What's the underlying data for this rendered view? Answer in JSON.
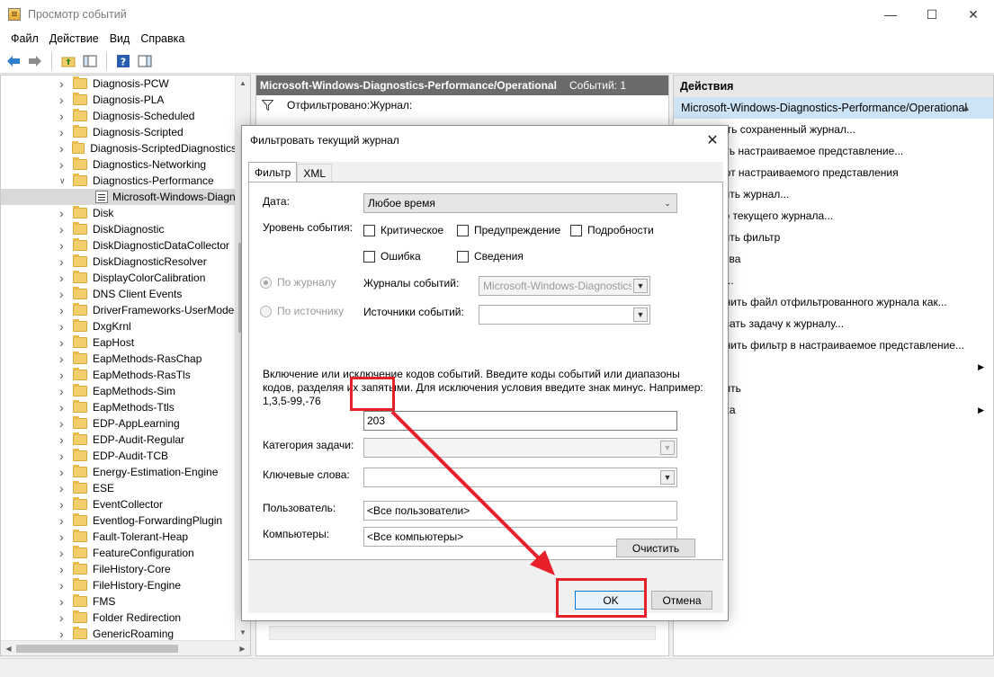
{
  "window": {
    "title": "Просмотр событий"
  },
  "menu": [
    "Файл",
    "Действие",
    "Вид",
    "Справка"
  ],
  "tree": {
    "items": [
      {
        "label": "Diagnosis-PCW",
        "expanded": false
      },
      {
        "label": "Diagnosis-PLA",
        "expanded": false
      },
      {
        "label": "Diagnosis-Scheduled",
        "expanded": false
      },
      {
        "label": "Diagnosis-Scripted",
        "expanded": false
      },
      {
        "label": "Diagnosis-ScriptedDiagnostics",
        "expanded": false
      },
      {
        "label": "Diagnostics-Networking",
        "expanded": false
      },
      {
        "label": "Diagnostics-Performance",
        "expanded": true
      },
      {
        "label": "Microsoft-Windows-Diagn",
        "child": true,
        "selected": true
      },
      {
        "label": "Disk",
        "expanded": false
      },
      {
        "label": "DiskDiagnostic",
        "expanded": false
      },
      {
        "label": "DiskDiagnosticDataCollector",
        "expanded": false
      },
      {
        "label": "DiskDiagnosticResolver",
        "expanded": false
      },
      {
        "label": "DisplayColorCalibration",
        "expanded": false
      },
      {
        "label": "DNS Client Events",
        "expanded": false
      },
      {
        "label": "DriverFrameworks-UserMode",
        "expanded": false
      },
      {
        "label": "DxgKrnl",
        "expanded": false
      },
      {
        "label": "EapHost",
        "expanded": false
      },
      {
        "label": "EapMethods-RasChap",
        "expanded": false
      },
      {
        "label": "EapMethods-RasTls",
        "expanded": false
      },
      {
        "label": "EapMethods-Sim",
        "expanded": false
      },
      {
        "label": "EapMethods-Ttls",
        "expanded": false
      },
      {
        "label": "EDP-AppLearning",
        "expanded": false
      },
      {
        "label": "EDP-Audit-Regular",
        "expanded": false
      },
      {
        "label": "EDP-Audit-TCB",
        "expanded": false
      },
      {
        "label": "Energy-Estimation-Engine",
        "expanded": false
      },
      {
        "label": "ESE",
        "expanded": false
      },
      {
        "label": "EventCollector",
        "expanded": false
      },
      {
        "label": "Eventlog-ForwardingPlugin",
        "expanded": false
      },
      {
        "label": "Fault-Tolerant-Heap",
        "expanded": false
      },
      {
        "label": "FeatureConfiguration",
        "expanded": false
      },
      {
        "label": "FileHistory-Core",
        "expanded": false
      },
      {
        "label": "FileHistory-Engine",
        "expanded": false
      },
      {
        "label": "FMS",
        "expanded": false
      },
      {
        "label": "Folder Redirection",
        "expanded": false
      },
      {
        "label": "GenericRoaming",
        "expanded": false
      }
    ]
  },
  "middle": {
    "header": "Microsoft-Windows-Diagnostics-Performance/Operational",
    "count": "Событий: 1",
    "filter_text": "Отфильтровано:Журнал:"
  },
  "right": {
    "header": "Действия",
    "subheader": "Microsoft-Windows-Diagnostics-Performance/Operational",
    "actions": [
      {
        "label": "ыть сохраненный журнал...",
        "submenu": false
      },
      {
        "label": "ать настраиваемое представление...",
        "submenu": false
      },
      {
        "label": "орт настраиваемого представления",
        "submenu": false
      },
      {
        "label": "тить журнал...",
        "submenu": false
      },
      {
        "label": "тр текущего журнала...",
        "submenu": false
      },
      {
        "label": "тить фильтр",
        "submenu": false
      },
      {
        "label": "ства",
        "submenu": false
      },
      {
        "label": "и...",
        "submenu": false
      },
      {
        "label": "анить файл отфильтрованного журнала как...",
        "submenu": false
      },
      {
        "label": "язать задачу к журналу...",
        "submenu": false
      },
      {
        "label": "анить фильтр в настраиваемое представление...",
        "submenu": false
      },
      {
        "label": "",
        "submenu": true
      },
      {
        "label": "вить",
        "submenu": false
      },
      {
        "label": "вка",
        "submenu": true
      }
    ]
  },
  "dialog": {
    "title": "Фильтровать текущий журнал",
    "tabs": [
      "Фильтр",
      "XML"
    ],
    "date_label": "Дата:",
    "date_value": "Любое время",
    "level_label": "Уровень события:",
    "levels": [
      "Критическое",
      "Предупреждение",
      "Подробности",
      "Ошибка",
      "Сведения"
    ],
    "by_log": "По журналу",
    "by_source": "По источнику",
    "logs_label": "Журналы событий:",
    "logs_value": "Microsoft-Windows-Diagnostics",
    "sources_label": "Источники событий:",
    "description": "Включение или исключение кодов событий. Введите коды событий или диапазоны кодов, разделяя их запятыми. Для исключения условия введите знак минус. Например: 1,3,5-99,-76",
    "event_ids_value": "203",
    "task_label": "Категория задачи:",
    "keywords_label": "Ключевые слова:",
    "user_label": "Пользователь:",
    "user_value": "<Все пользователи>",
    "computer_label": "Компьютеры:",
    "computer_value": "<Все компьютеры>",
    "clear_button": "Очистить",
    "ok_button": "OK",
    "cancel_button": "Отмена"
  },
  "annotation_color": "#e8202a"
}
